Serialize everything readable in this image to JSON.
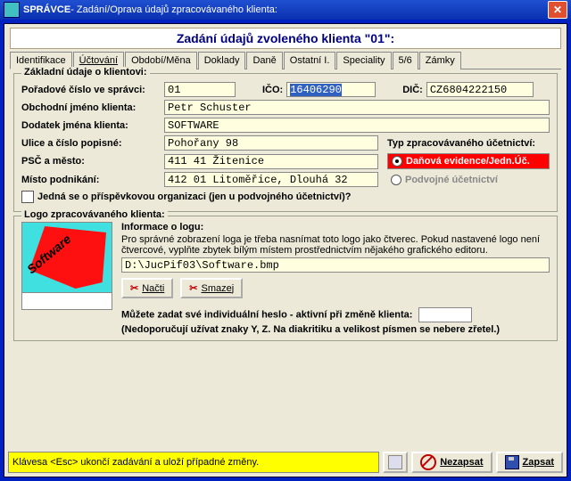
{
  "title_prefix": "SPRÁVCE",
  "title_rest": " - Zadání/Oprava údajů zpracovávaného klienta:",
  "header": "Zadání údajů zvoleného klienta \"01\":",
  "tabs": [
    "Identifikace",
    "Účtování",
    "Období/Měna",
    "Doklady",
    "Daně",
    "Ostatní I.",
    "Speciality",
    "5/6",
    "Zámky"
  ],
  "fs_basic": "Základní údaje o klientovi:",
  "lbl_poradove": "Pořadové číslo ve správci:",
  "val_poradove": "01",
  "lbl_ico": "IČO:",
  "val_ico": "16406290",
  "lbl_dic": "DIČ:",
  "val_dic": "CZ6804222150",
  "lbl_obchjm": "Obchodní jméno klienta:",
  "val_obchjm": "Petr Schuster",
  "lbl_dodatek": "Dodatek jména klienta:",
  "val_dodatek": "SOFTWARE",
  "lbl_ulice": "Ulice a číslo popisné:",
  "val_ulice": "Pohořany 98",
  "lbl_psc": "PSČ a město:",
  "val_psc": "411 41 Žitenice",
  "lbl_misto": "Místo podnikání:",
  "val_misto": "412 01 Litoměřice, Dlouhá 32",
  "lbl_typ": "Typ zpracovávaného účetnictví:",
  "radio_dan": "Daňová evidence/Jedn.Úč.",
  "radio_podv": "Podvojné účetnictví",
  "chk_prispevek": "Jedná se o příspěvkovou organizaci (jen u podvojného účetnictví)?",
  "fs_logo": "Logo zpracovávaného klienta:",
  "logo_info_t": "Informace o logu:",
  "logo_info": "Pro správné zobrazení  loga je třeba nasnímat toto logo jako čtverec. Pokud nastavené logo není čtvercové, vyplňte zbytek  bílým místem  prostřednictvím  nějakého grafického editoru.",
  "logo_path": "D:\\JucPif03\\Software.bmp",
  "btn_nacti": "Načti",
  "btn_smazej": "Smazej",
  "pwd_lbl": "Můžete zadat své individuální heslo - aktivní při změně klienta:",
  "pwd_note": "(Nedoporučují užívat znaky Y, Z. Na diakritiku a velikost písmen se nebere zřetel.)",
  "status": "Klávesa <Esc> ukončí zadávání a uloží případné změny.",
  "btn_nezapsat": "Nezapsat",
  "btn_zapsat": "Zapsat",
  "logo_word": "Software"
}
